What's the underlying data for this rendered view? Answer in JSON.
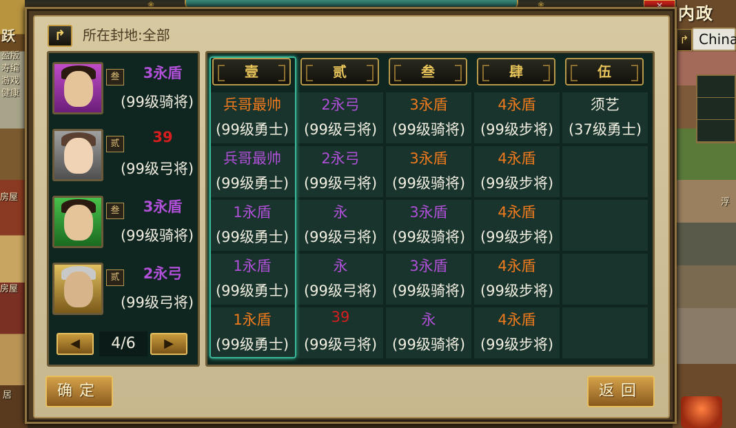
{
  "colors": {
    "purple": "#b050d8",
    "orange": "#f07a1e",
    "red": "#d81e1e",
    "white": "#f2efe2"
  },
  "top": {
    "title": "",
    "right_label": "内政",
    "left_label": "跃",
    "region_input": "China"
  },
  "filter": {
    "label": "所在封地:全部"
  },
  "side_left": [
    "盈版",
    "寿编",
    "游戏",
    "健康",
    "房屋",
    "房屋",
    "居"
  ],
  "side_right": [
    "浮"
  ],
  "generals": [
    {
      "name": "3永盾",
      "color": "purple",
      "rank_badge": "叁",
      "desc": "(99级骑将)",
      "portrait": "purple"
    },
    {
      "name": "39",
      "color": "red",
      "rank_badge": "贰",
      "desc": "(99级弓将)",
      "portrait": "grey"
    },
    {
      "name": "3永盾",
      "color": "purple",
      "rank_badge": "叁",
      "desc": "(99级骑将)",
      "portrait": "green"
    },
    {
      "name": "2永弓",
      "color": "purple",
      "rank_badge": "贰",
      "desc": "(99级弓将)",
      "portrait": "gold"
    }
  ],
  "pager": {
    "prev": "◀",
    "next": "▶",
    "count": "4/6"
  },
  "columns": [
    "壹",
    "贰",
    "叁",
    "肆",
    "伍"
  ],
  "grid": [
    [
      {
        "name": "兵哥最帅",
        "color": "orange",
        "desc": "(99级勇士)"
      },
      {
        "name": "2永弓",
        "color": "purple",
        "desc": "(99级弓将)"
      },
      {
        "name": "3永盾",
        "color": "orange",
        "desc": "(99级骑将)"
      },
      {
        "name": "4永盾",
        "color": "orange",
        "desc": "(99级步将)"
      },
      {
        "name": "须艺",
        "color": "white",
        "desc": "(37级勇士)"
      }
    ],
    [
      {
        "name": "兵哥最帅",
        "color": "purple",
        "desc": "(99级勇士)"
      },
      {
        "name": "2永弓",
        "color": "purple",
        "desc": "(99级弓将)"
      },
      {
        "name": "3永盾",
        "color": "orange",
        "desc": "(99级骑将)"
      },
      {
        "name": "4永盾",
        "color": "orange",
        "desc": "(99级步将)"
      },
      null
    ],
    [
      {
        "name": "1永盾",
        "color": "purple",
        "desc": "(99级勇士)"
      },
      {
        "name": "永",
        "color": "purple",
        "desc": "(99级弓将)"
      },
      {
        "name": "3永盾",
        "color": "purple",
        "desc": "(99级骑将)"
      },
      {
        "name": "4永盾",
        "color": "orange",
        "desc": "(99级步将)"
      },
      null
    ],
    [
      {
        "name": "1永盾",
        "color": "purple",
        "desc": "(99级勇士)"
      },
      {
        "name": "永",
        "color": "purple",
        "desc": "(99级弓将)"
      },
      {
        "name": "3永盾",
        "color": "purple",
        "desc": "(99级骑将)"
      },
      {
        "name": "4永盾",
        "color": "orange",
        "desc": "(99级步将)"
      },
      null
    ],
    [
      {
        "name": "1永盾",
        "color": "orange",
        "desc": "(99级勇士)"
      },
      {
        "name": "39",
        "color": "red",
        "desc": "(99级弓将)"
      },
      {
        "name": "永",
        "color": "purple",
        "desc": "(99级骑将)"
      },
      {
        "name": "4永盾",
        "color": "orange",
        "desc": "(99级步将)"
      },
      null
    ]
  ],
  "buttons": {
    "confirm": "确定",
    "back": "返回"
  }
}
